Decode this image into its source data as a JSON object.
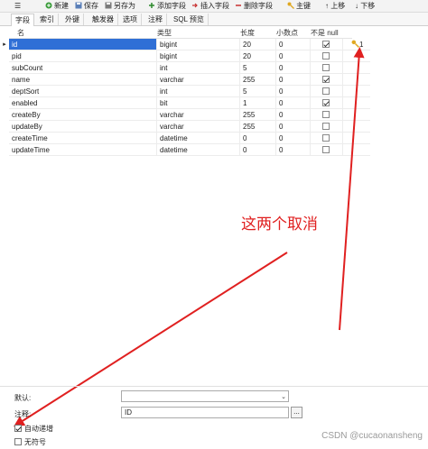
{
  "toolbar": {
    "new_label": "新建",
    "save_label": "保存",
    "save_as_label": "另存为",
    "add_field_label": "添加字段",
    "insert_field_label": "插入字段",
    "delete_field_label": "删除字段",
    "primary_key_label": "主键",
    "move_up_label": "上移",
    "move_down_label": "下移"
  },
  "tabs": [
    "字段",
    "索引",
    "外键",
    "触发器",
    "选项",
    "注释",
    "SQL 预览"
  ],
  "grid": {
    "headers": {
      "name": "名",
      "type": "类型",
      "length": "长度",
      "decimals": "小数点",
      "not_null": "不是 null"
    },
    "primary_key_index": "1",
    "rows": [
      {
        "name": "id",
        "type": "bigint",
        "length": "20",
        "decimals": "0",
        "not_null": true
      },
      {
        "name": "pid",
        "type": "bigint",
        "length": "20",
        "decimals": "0",
        "not_null": false
      },
      {
        "name": "subCount",
        "type": "int",
        "length": "5",
        "decimals": "0",
        "not_null": false
      },
      {
        "name": "name",
        "type": "varchar",
        "length": "255",
        "decimals": "0",
        "not_null": true
      },
      {
        "name": "deptSort",
        "type": "int",
        "length": "5",
        "decimals": "0",
        "not_null": false
      },
      {
        "name": "enabled",
        "type": "bit",
        "length": "1",
        "decimals": "0",
        "not_null": true
      },
      {
        "name": "createBy",
        "type": "varchar",
        "length": "255",
        "decimals": "0",
        "not_null": false
      },
      {
        "name": "updateBy",
        "type": "varchar",
        "length": "255",
        "decimals": "0",
        "not_null": false
      },
      {
        "name": "createTime",
        "type": "datetime",
        "length": "0",
        "decimals": "0",
        "not_null": false
      },
      {
        "name": "updateTime",
        "type": "datetime",
        "length": "0",
        "decimals": "0",
        "not_null": false
      }
    ]
  },
  "annotation": "这两个取消",
  "bottom": {
    "default_label": "默认:",
    "default_value": "",
    "comment_label": "注释:",
    "comment_value": "ID",
    "ellipsis": "...",
    "auto_increment_label": "自动递增",
    "auto_increment_checked": true,
    "unsigned_label": "无符号",
    "unsigned_checked": false
  },
  "watermark": "CSDN @cucaonansheng",
  "colors": {
    "selected_row": "#2f6fd6",
    "annotation": "#e02020"
  }
}
